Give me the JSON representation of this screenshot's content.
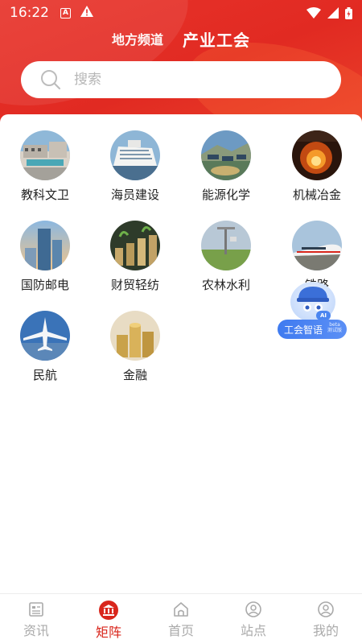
{
  "status_bar": {
    "time": "16:22"
  },
  "header": {
    "tab_local": "地方频道",
    "tab_industry": "产业工会"
  },
  "search": {
    "placeholder": "搜索"
  },
  "categories": [
    {
      "label": "教科文卫",
      "icon": "school-building-photo"
    },
    {
      "label": "海员建设",
      "icon": "cruise-ship-photo"
    },
    {
      "label": "能源化学",
      "icon": "solar-plant-photo"
    },
    {
      "label": "机械冶金",
      "icon": "molten-metal-photo"
    },
    {
      "label": "国防邮电",
      "icon": "skyscraper-photo"
    },
    {
      "label": "财贸轻纺",
      "icon": "coins-plant-photo"
    },
    {
      "label": "农林水利",
      "icon": "farm-weather-station-photo"
    },
    {
      "label": "铁路",
      "icon": "bullet-train-photo"
    },
    {
      "label": "民航",
      "icon": "airplane-photo"
    },
    {
      "label": "金融",
      "icon": "coin-stack-photo"
    }
  ],
  "ai_assistant": {
    "label": "工会智语",
    "badge": "AI",
    "beta": "beta",
    "beta_sub": "测试版"
  },
  "bottom_nav": [
    {
      "label": "资讯",
      "icon": "news-icon",
      "active": false
    },
    {
      "label": "矩阵",
      "icon": "bank-icon",
      "active": true
    },
    {
      "label": "首页",
      "icon": "home-icon",
      "active": false
    },
    {
      "label": "站点",
      "icon": "site-icon",
      "active": false
    },
    {
      "label": "我的",
      "icon": "profile-icon",
      "active": false
    }
  ],
  "colors": {
    "brand_red": "#e12a22",
    "active_nav": "#d9261c",
    "ai_blue": "#4a85f0"
  }
}
